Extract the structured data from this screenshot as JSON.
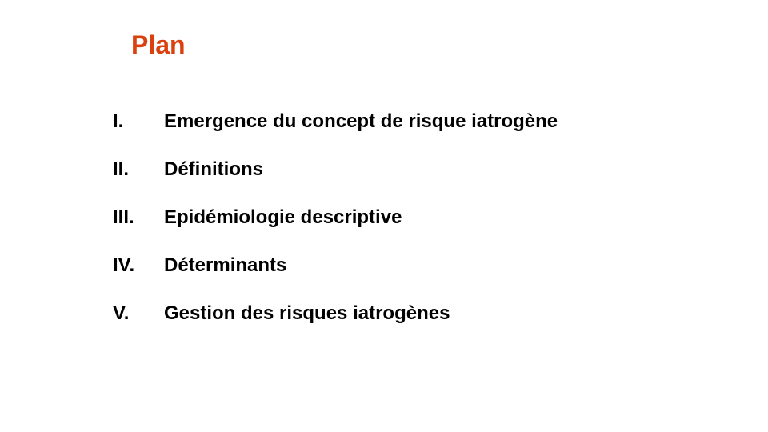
{
  "slide": {
    "title": "Plan",
    "title_color": "#d9410f",
    "outline": [
      {
        "numeral": "I.",
        "label": "Emergence du concept de risque iatrogène"
      },
      {
        "numeral": "II.",
        "label": "Définitions"
      },
      {
        "numeral": "III.",
        "label": "Epidémiologie descriptive"
      },
      {
        "numeral": "IV.",
        "label": "Déterminants"
      },
      {
        "numeral": "V.",
        "label": "Gestion des risques iatrogènes"
      }
    ]
  }
}
